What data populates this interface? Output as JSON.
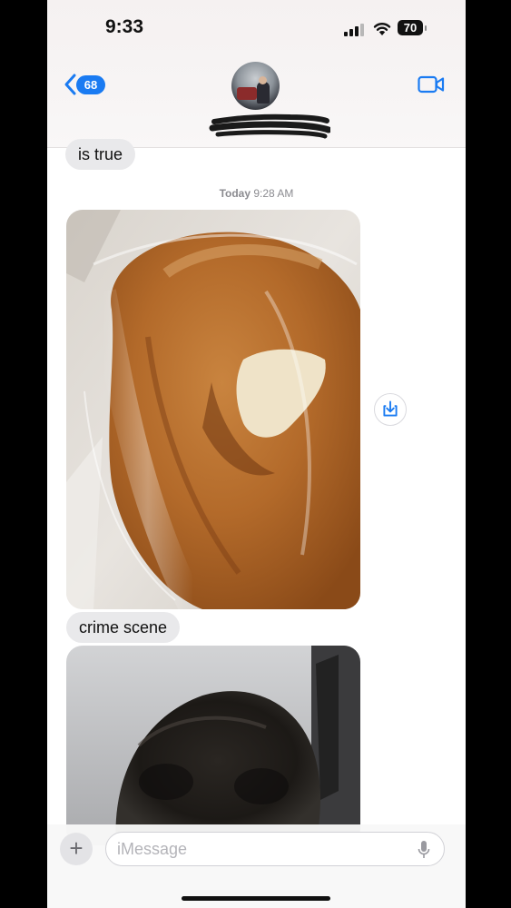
{
  "status_bar": {
    "time": "9:33",
    "battery": "70"
  },
  "header": {
    "unread_count": "68"
  },
  "messages": [
    {
      "type": "text",
      "text": "is true"
    },
    {
      "type": "timestamp",
      "day": "Today",
      "time": "9:28 AM"
    },
    {
      "type": "photo",
      "subject": "bread loaf in plastic bag with torn crust"
    },
    {
      "type": "text",
      "text": "crime scene"
    },
    {
      "type": "photo",
      "subject": "dark blurred cat close-up"
    }
  ],
  "composer": {
    "placeholder": "iMessage",
    "plus_label": "+"
  },
  "icons": {
    "back": "chevron-left-icon",
    "video": "video-camera-icon",
    "save": "download-icon",
    "mic": "microphone-icon"
  },
  "colors": {
    "accent": "#1a7bf2",
    "bubble_gray": "#e9e9eb"
  }
}
